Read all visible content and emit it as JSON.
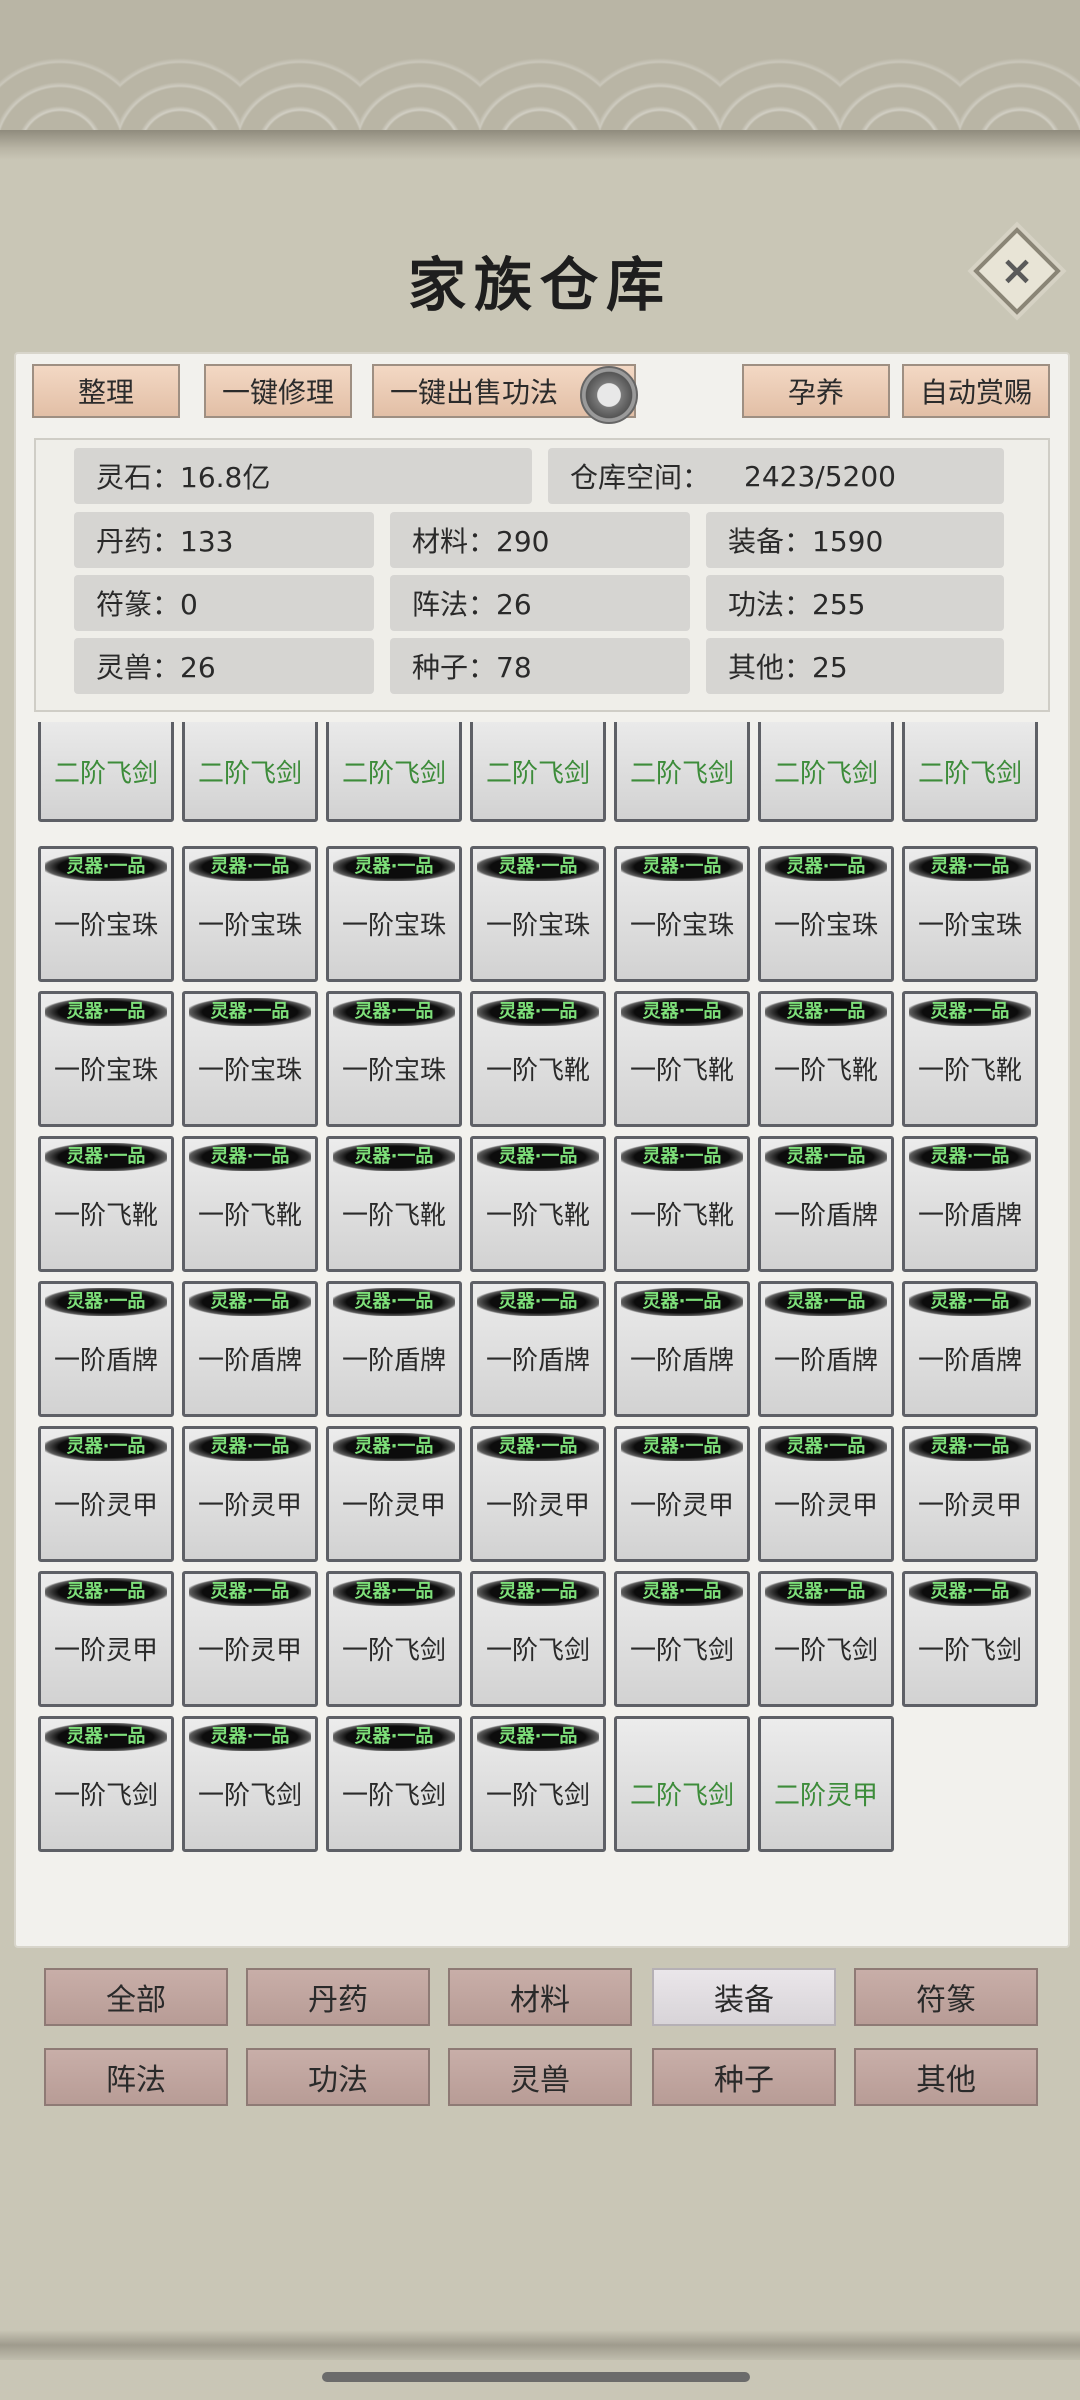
{
  "header": {
    "title": "家族仓库",
    "close_icon": "×"
  },
  "toolbar": {
    "sort": "整理",
    "repair_all": "一键修理",
    "sell_skills": "一键出售功法",
    "nurture": "孕养",
    "auto_reward": "自动赏赐"
  },
  "stats": {
    "spirit_stone": "灵石：16.8亿",
    "storage_label": "仓库空间：",
    "storage_value": "2423/5200",
    "pills": "丹药：133",
    "materials": "材料：290",
    "equipment": "装备：1590",
    "talismans": "符篆：0",
    "formations": "阵法：26",
    "skills": "功法：255",
    "beasts": "灵兽：26",
    "seeds": "种子：78",
    "others": "其他：25"
  },
  "items": [
    {
      "tag": "",
      "name": "二阶飞剑",
      "tier": 2
    },
    {
      "tag": "",
      "name": "二阶飞剑",
      "tier": 2
    },
    {
      "tag": "",
      "name": "二阶飞剑",
      "tier": 2
    },
    {
      "tag": "",
      "name": "二阶飞剑",
      "tier": 2
    },
    {
      "tag": "",
      "name": "二阶飞剑",
      "tier": 2
    },
    {
      "tag": "",
      "name": "二阶飞剑",
      "tier": 2
    },
    {
      "tag": "",
      "name": "二阶飞剑",
      "tier": 2
    },
    {
      "tag": "灵器·一品",
      "name": "一阶宝珠",
      "tier": 1
    },
    {
      "tag": "灵器·一品",
      "name": "一阶宝珠",
      "tier": 1
    },
    {
      "tag": "灵器·一品",
      "name": "一阶宝珠",
      "tier": 1
    },
    {
      "tag": "灵器·一品",
      "name": "一阶宝珠",
      "tier": 1
    },
    {
      "tag": "灵器·一品",
      "name": "一阶宝珠",
      "tier": 1
    },
    {
      "tag": "灵器·一品",
      "name": "一阶宝珠",
      "tier": 1
    },
    {
      "tag": "灵器·一品",
      "name": "一阶宝珠",
      "tier": 1
    },
    {
      "tag": "灵器·一品",
      "name": "一阶宝珠",
      "tier": 1
    },
    {
      "tag": "灵器·一品",
      "name": "一阶宝珠",
      "tier": 1
    },
    {
      "tag": "灵器·一品",
      "name": "一阶宝珠",
      "tier": 1
    },
    {
      "tag": "灵器·一品",
      "name": "一阶飞靴",
      "tier": 1
    },
    {
      "tag": "灵器·一品",
      "name": "一阶飞靴",
      "tier": 1
    },
    {
      "tag": "灵器·一品",
      "name": "一阶飞靴",
      "tier": 1
    },
    {
      "tag": "灵器·一品",
      "name": "一阶飞靴",
      "tier": 1
    },
    {
      "tag": "灵器·一品",
      "name": "一阶飞靴",
      "tier": 1
    },
    {
      "tag": "灵器·一品",
      "name": "一阶飞靴",
      "tier": 1
    },
    {
      "tag": "灵器·一品",
      "name": "一阶飞靴",
      "tier": 1
    },
    {
      "tag": "灵器·一品",
      "name": "一阶飞靴",
      "tier": 1
    },
    {
      "tag": "灵器·一品",
      "name": "一阶飞靴",
      "tier": 1
    },
    {
      "tag": "灵器·一品",
      "name": "一阶盾牌",
      "tier": 1
    },
    {
      "tag": "灵器·一品",
      "name": "一阶盾牌",
      "tier": 1
    },
    {
      "tag": "灵器·一品",
      "name": "一阶盾牌",
      "tier": 1
    },
    {
      "tag": "灵器·一品",
      "name": "一阶盾牌",
      "tier": 1
    },
    {
      "tag": "灵器·一品",
      "name": "一阶盾牌",
      "tier": 1
    },
    {
      "tag": "灵器·一品",
      "name": "一阶盾牌",
      "tier": 1
    },
    {
      "tag": "灵器·一品",
      "name": "一阶盾牌",
      "tier": 1
    },
    {
      "tag": "灵器·一品",
      "name": "一阶盾牌",
      "tier": 1
    },
    {
      "tag": "灵器·一品",
      "name": "一阶盾牌",
      "tier": 1
    },
    {
      "tag": "灵器·一品",
      "name": "一阶灵甲",
      "tier": 1
    },
    {
      "tag": "灵器·一品",
      "name": "一阶灵甲",
      "tier": 1
    },
    {
      "tag": "灵器·一品",
      "name": "一阶灵甲",
      "tier": 1
    },
    {
      "tag": "灵器·一品",
      "name": "一阶灵甲",
      "tier": 1
    },
    {
      "tag": "灵器·一品",
      "name": "一阶灵甲",
      "tier": 1
    },
    {
      "tag": "灵器·一品",
      "name": "一阶灵甲",
      "tier": 1
    },
    {
      "tag": "灵器·一品",
      "name": "一阶灵甲",
      "tier": 1
    },
    {
      "tag": "灵器·一品",
      "name": "一阶灵甲",
      "tier": 1
    },
    {
      "tag": "灵器·一品",
      "name": "一阶灵甲",
      "tier": 1
    },
    {
      "tag": "灵器·一品",
      "name": "一阶飞剑",
      "tier": 1
    },
    {
      "tag": "灵器·一品",
      "name": "一阶飞剑",
      "tier": 1
    },
    {
      "tag": "灵器·一品",
      "name": "一阶飞剑",
      "tier": 1
    },
    {
      "tag": "灵器·一品",
      "name": "一阶飞剑",
      "tier": 1
    },
    {
      "tag": "灵器·一品",
      "name": "一阶飞剑",
      "tier": 1
    },
    {
      "tag": "灵器·一品",
      "name": "一阶飞剑",
      "tier": 1
    },
    {
      "tag": "灵器·一品",
      "name": "一阶飞剑",
      "tier": 1
    },
    {
      "tag": "灵器·一品",
      "name": "一阶飞剑",
      "tier": 1
    },
    {
      "tag": "灵器·一品",
      "name": "一阶飞剑",
      "tier": 1
    },
    {
      "tag": "",
      "name": "二阶飞剑",
      "tier": 2
    },
    {
      "tag": "",
      "name": "二阶灵甲",
      "tier": 2
    }
  ],
  "categories": [
    "全部",
    "丹药",
    "材料",
    "装备",
    "符篆",
    "阵法",
    "功法",
    "灵兽",
    "种子",
    "其他"
  ],
  "active_category": "装备"
}
